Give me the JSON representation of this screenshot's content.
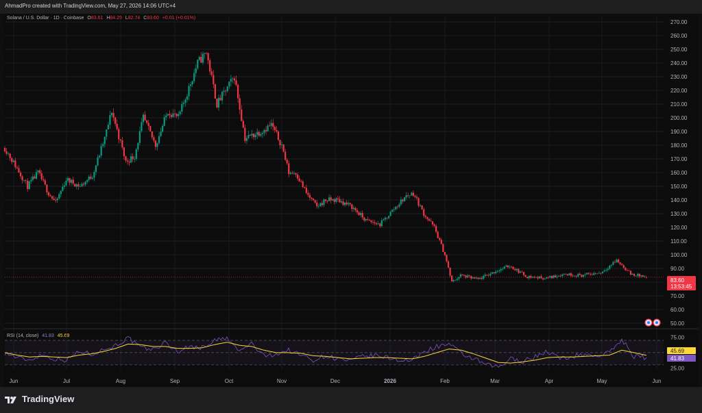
{
  "attribution": "AhmadPro created with TradingView.com, May 27, 2026 14:06 UTC+4",
  "legend": {
    "symbol": "Solana / U.S. Dollar · 1D · Coinbase",
    "o_label": "O",
    "o_value": "83.61",
    "h_label": "H",
    "h_value": "84.29",
    "l_label": "L",
    "l_value": "82.74",
    "c_label": "C",
    "c_value": "83.60",
    "change": "+0.01 (+0.01%)"
  },
  "price_badge": {
    "price": "83.60",
    "countdown": "13:53:45"
  },
  "rsi_legend": {
    "name": "RSI (14, close)",
    "rsi_value": "41.83",
    "ma_value": "45.69"
  },
  "brand": "TradingView",
  "colors": {
    "up": "#089981",
    "down": "#f23645",
    "rsi": "#7e57c2",
    "rsi_ma": "#fdd835",
    "background": "#0c0c0c"
  },
  "chart_data": [
    {
      "type": "candlestick",
      "y_scale": "price (USD)",
      "ylim": [
        48,
        274
      ],
      "price_ticks": [
        50,
        60,
        70,
        80,
        90,
        100,
        110,
        120,
        130,
        140,
        150,
        160,
        170,
        180,
        190,
        200,
        210,
        220,
        230,
        240,
        250,
        260,
        270
      ],
      "x_labels": [
        "Jun",
        "Jul",
        "Aug",
        "Sep",
        "Oct",
        "Nov",
        "Dec",
        "2026",
        "Feb",
        "Mar",
        "Apr",
        "May",
        "Jun"
      ],
      "grid": true,
      "last_price": 83.6,
      "close_path": [
        {
          "d": "2025-05-26",
          "p": 178
        },
        {
          "d": "2025-06-02",
          "p": 163
        },
        {
          "d": "2025-06-08",
          "p": 150
        },
        {
          "d": "2025-06-14",
          "p": 160
        },
        {
          "d": "2025-06-20",
          "p": 145
        },
        {
          "d": "2025-06-24",
          "p": 138
        },
        {
          "d": "2025-06-30",
          "p": 155
        },
        {
          "d": "2025-07-08",
          "p": 150
        },
        {
          "d": "2025-07-15",
          "p": 158
        },
        {
          "d": "2025-07-22",
          "p": 185
        },
        {
          "d": "2025-07-26",
          "p": 205
        },
        {
          "d": "2025-08-03",
          "p": 168
        },
        {
          "d": "2025-08-08",
          "p": 172
        },
        {
          "d": "2025-08-13",
          "p": 200
        },
        {
          "d": "2025-08-20",
          "p": 180
        },
        {
          "d": "2025-08-27",
          "p": 205
        },
        {
          "d": "2025-09-02",
          "p": 200
        },
        {
          "d": "2025-09-13",
          "p": 240
        },
        {
          "d": "2025-09-18",
          "p": 248
        },
        {
          "d": "2025-09-24",
          "p": 210
        },
        {
          "d": "2025-10-04",
          "p": 230
        },
        {
          "d": "2025-10-10",
          "p": 185
        },
        {
          "d": "2025-10-19",
          "p": 190
        },
        {
          "d": "2025-10-25",
          "p": 195
        },
        {
          "d": "2025-10-31",
          "p": 180
        },
        {
          "d": "2025-11-04",
          "p": 160
        },
        {
          "d": "2025-11-08",
          "p": 160
        },
        {
          "d": "2025-11-14",
          "p": 145
        },
        {
          "d": "2025-11-20",
          "p": 135
        },
        {
          "d": "2025-11-25",
          "p": 140
        },
        {
          "d": "2025-12-02",
          "p": 140
        },
        {
          "d": "2025-12-10",
          "p": 135
        },
        {
          "d": "2025-12-18",
          "p": 125
        },
        {
          "d": "2025-12-26",
          "p": 122
        },
        {
          "d": "2026-01-04",
          "p": 135
        },
        {
          "d": "2026-01-10",
          "p": 143
        },
        {
          "d": "2026-01-14",
          "p": 145
        },
        {
          "d": "2026-01-20",
          "p": 130
        },
        {
          "d": "2026-01-26",
          "p": 120
        },
        {
          "d": "2026-02-01",
          "p": 100
        },
        {
          "d": "2026-02-05",
          "p": 80
        },
        {
          "d": "2026-02-10",
          "p": 85
        },
        {
          "d": "2026-02-20",
          "p": 82
        },
        {
          "d": "2026-03-02",
          "p": 88
        },
        {
          "d": "2026-03-10",
          "p": 92
        },
        {
          "d": "2026-03-20",
          "p": 84
        },
        {
          "d": "2026-03-31",
          "p": 83
        },
        {
          "d": "2026-04-10",
          "p": 86
        },
        {
          "d": "2026-04-20",
          "p": 85
        },
        {
          "d": "2026-05-01",
          "p": 87
        },
        {
          "d": "2026-05-10",
          "p": 96
        },
        {
          "d": "2026-05-18",
          "p": 86
        },
        {
          "d": "2026-05-27",
          "p": 83.6
        }
      ]
    },
    {
      "type": "line",
      "title": "RSI (14, close)",
      "ylim": [
        22,
        80
      ],
      "ticks": [
        25,
        75
      ],
      "levels": [
        30,
        50,
        70
      ],
      "series": [
        {
          "name": "RSI",
          "current": 41.83,
          "values": [
            50,
            42,
            38,
            47,
            40,
            38,
            52,
            48,
            55,
            62,
            74,
            58,
            55,
            66,
            52,
            60,
            58,
            70,
            73,
            52,
            65,
            44,
            48,
            54,
            46,
            38,
            45,
            40,
            36,
            44,
            45,
            42,
            38,
            37,
            52,
            60,
            64,
            48,
            40,
            30,
            26,
            40,
            36,
            44,
            52,
            40,
            44,
            47,
            45,
            50,
            72,
            44,
            41.83
          ]
        },
        {
          "name": "RSI MA",
          "current": 45.69,
          "values": [
            50,
            46,
            43,
            44,
            43,
            42,
            46,
            48,
            52,
            57,
            64,
            63,
            60,
            60,
            57,
            57,
            58,
            63,
            67,
            62,
            60,
            54,
            50,
            50,
            49,
            45,
            44,
            42,
            40,
            41,
            42,
            42,
            41,
            40,
            44,
            50,
            56,
            54,
            48,
            41,
            34,
            33,
            35,
            38,
            42,
            43,
            43,
            44,
            45,
            46,
            54,
            50,
            45.69
          ]
        }
      ]
    }
  ]
}
